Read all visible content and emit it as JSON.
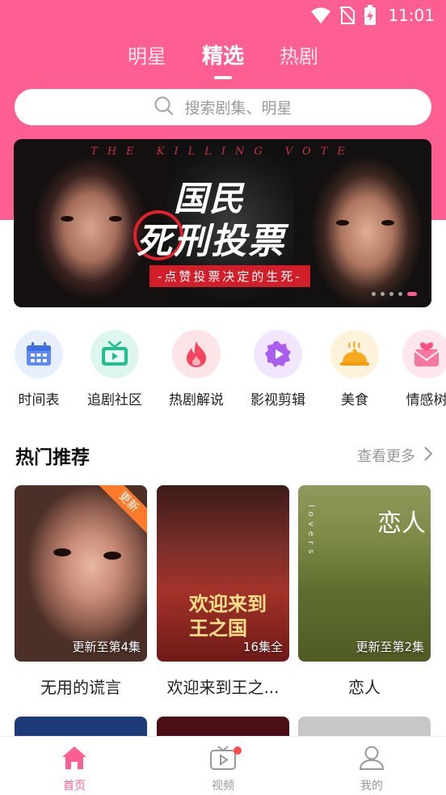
{
  "status_bar": {
    "time": "11:01",
    "icons": [
      "wifi-icon",
      "no-sim-icon",
      "battery-charging-icon"
    ]
  },
  "top_tabs": [
    {
      "label": "明星",
      "active": false
    },
    {
      "label": "精选",
      "active": true
    },
    {
      "label": "热剧",
      "active": false
    }
  ],
  "search": {
    "placeholder": "搜索剧集、明星",
    "icon": "search-icon"
  },
  "banner": {
    "subtitle": "THE KILLING VOTE",
    "title_line1": "国民",
    "title_line2": "死刑投票",
    "tagline": "-点赞投票决定的生死-",
    "slide_count": 5,
    "active_slide": 5
  },
  "categories": [
    {
      "label": "时间表",
      "icon": "calendar-icon",
      "color": "#5b8af5",
      "bg": "#e8effe"
    },
    {
      "label": "追剧社区",
      "icon": "tv-icon",
      "color": "#1fbf8f",
      "bg": "#ddf6ee"
    },
    {
      "label": "热剧解说",
      "icon": "flame-icon",
      "color": "#f7455f",
      "bg": "#fde4e6"
    },
    {
      "label": "影视剪辑",
      "icon": "play-badge-icon",
      "color": "#a95ef0",
      "bg": "#f1e6fd"
    },
    {
      "label": "美食",
      "icon": "food-cloche-icon",
      "color": "#f6a81e",
      "bg": "#fef3da"
    },
    {
      "label": "情感树",
      "icon": "heart-mail-icon",
      "color": "#f7789c",
      "bg": "#fde6ee"
    }
  ],
  "section": {
    "title": "热门推荐",
    "more_label": "查看更多"
  },
  "recommendations": [
    {
      "title": "无用的谎言",
      "caption": "更新至第4集",
      "ribbon": "更新"
    },
    {
      "title": "欢迎来到王之...",
      "caption": "16集全",
      "poster_text": "欢迎来到\n王之国"
    },
    {
      "title": "恋人",
      "caption": "更新至第2集",
      "poster_text": "恋人",
      "poster_vertical": "lovers"
    }
  ],
  "bottom_nav": [
    {
      "label": "首页",
      "icon": "home-icon",
      "active": true
    },
    {
      "label": "视频",
      "icon": "video-play-icon",
      "active": false,
      "badge": true
    },
    {
      "label": "我的",
      "icon": "profile-icon",
      "active": false
    }
  ],
  "colors": {
    "brand": "#fe5f92",
    "ribbon": "#fd7a2a",
    "badge": "#ff4b4b"
  }
}
